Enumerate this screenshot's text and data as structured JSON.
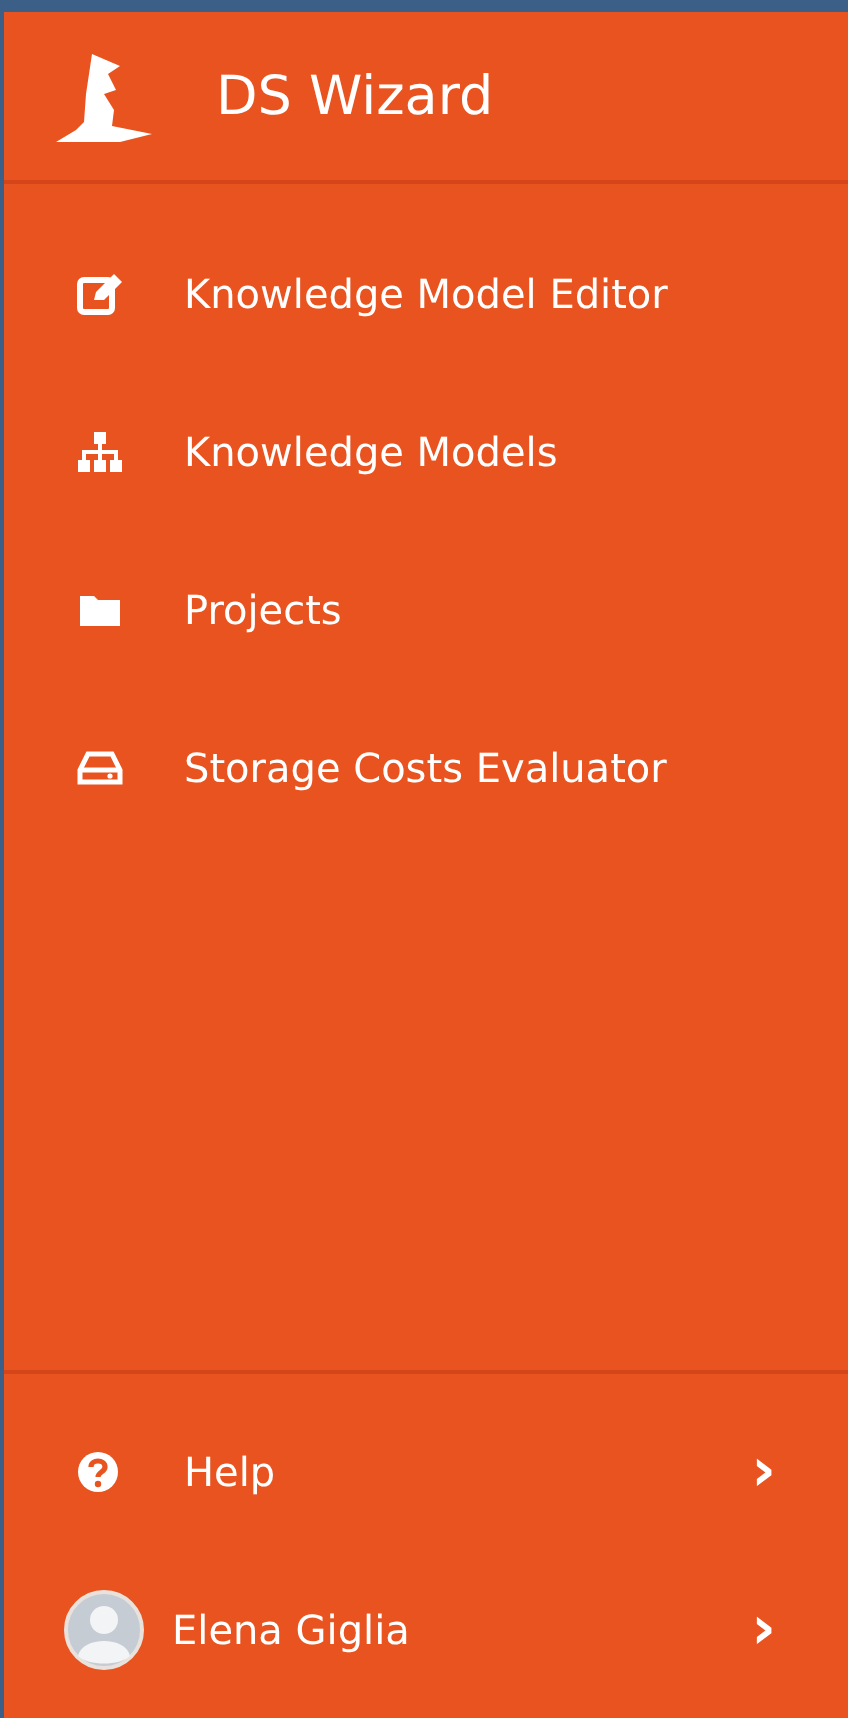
{
  "brand": {
    "title": "DS Wizard"
  },
  "menu": [
    {
      "kind": "edit",
      "label": "Knowledge Model Editor"
    },
    {
      "kind": "sitemap",
      "label": "Knowledge Models"
    },
    {
      "kind": "folder",
      "label": "Projects"
    },
    {
      "kind": "drive",
      "label": "Storage Costs Evaluator"
    }
  ],
  "footer": [
    {
      "kind": "help",
      "label": "Help",
      "chevron": "›"
    },
    {
      "kind": "user",
      "label": "Elena Giglia",
      "chevron": "›"
    }
  ]
}
